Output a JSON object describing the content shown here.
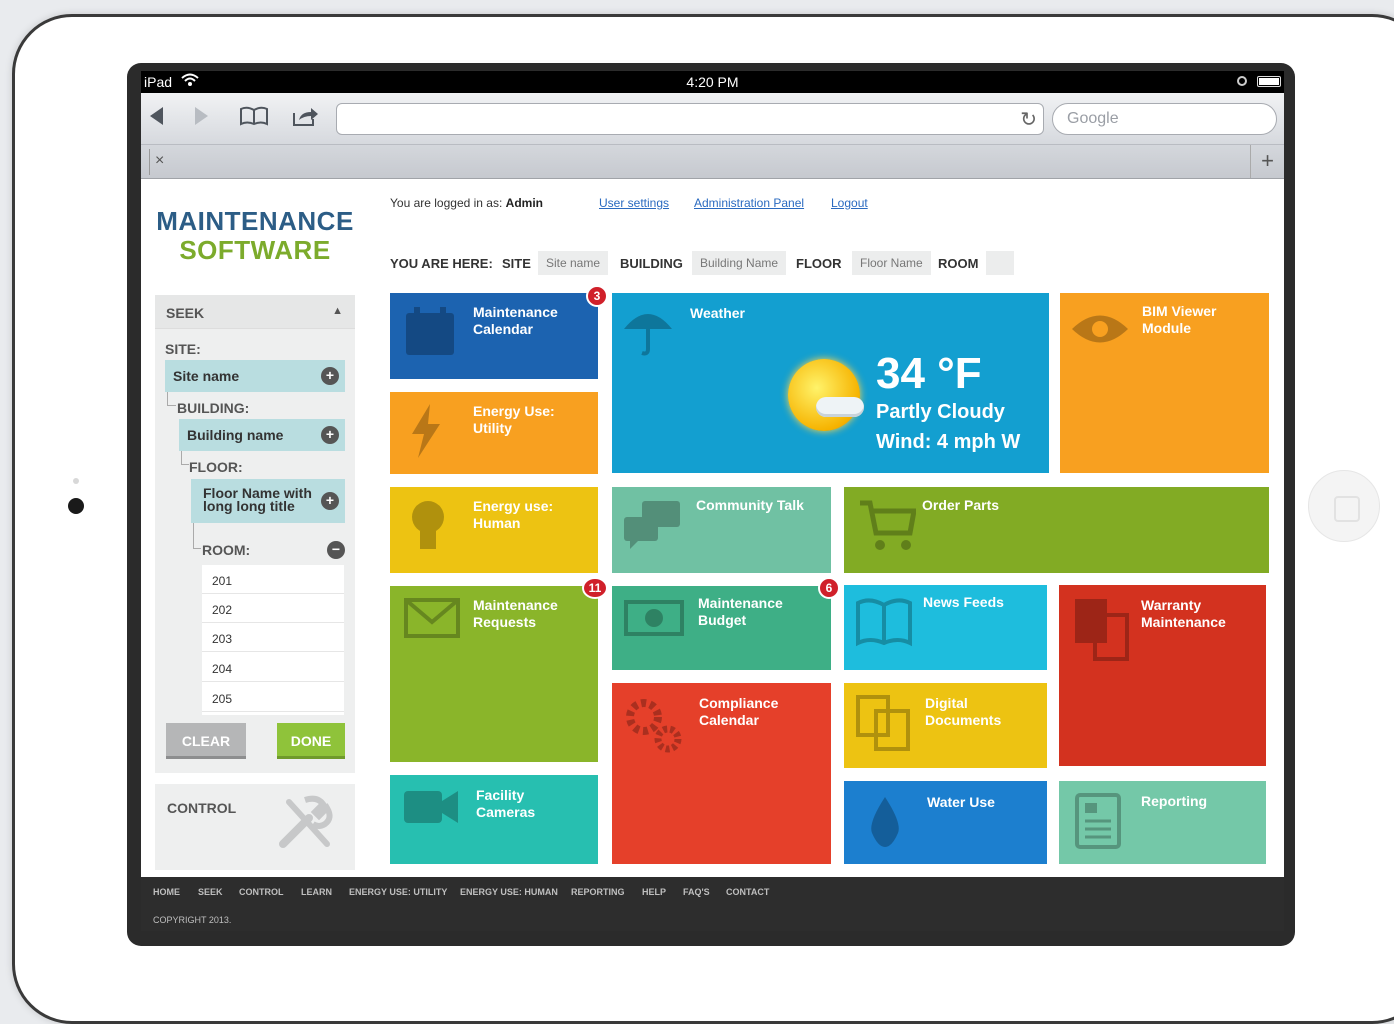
{
  "device": {
    "carrier": "iPad",
    "time": "4:20 PM"
  },
  "browser": {
    "search_placeholder": "Google",
    "tab_close": "×",
    "tab_add": "+"
  },
  "header": {
    "logo_line1": "MAINTENANCE",
    "logo_line2": "SOFTWARE",
    "logged_in_prefix": "You are logged in as: ",
    "logged_in_user": "Admin",
    "links": [
      "User settings",
      "Administration Panel",
      "Logout"
    ]
  },
  "breadcrumb": {
    "prefix": "YOU ARE HERE:",
    "site_label": "SITE",
    "site_value": "Site name",
    "building_label": "BUILDING",
    "building_value": "Building Name",
    "floor_label": "FLOOR",
    "floor_value": "Floor Name",
    "room_label": "ROOM",
    "room_value": ""
  },
  "seek": {
    "title": "SEEK",
    "site_label": "SITE:",
    "site_value": "Site name",
    "building_label": "BUILDING:",
    "building_value": "Building name",
    "floor_label": "FLOOR:",
    "floor_value": "Floor Name with long long title",
    "room_label": "ROOM:",
    "rooms": [
      "201",
      "202",
      "203",
      "204",
      "205"
    ],
    "clear_label": "CLEAR",
    "done_label": "DONE"
  },
  "control": {
    "title": "CONTROL"
  },
  "tiles": {
    "maintenance_calendar": {
      "label": "Maintenance\nCalendar",
      "badge": "3",
      "color": "#1c63b0"
    },
    "energy_utility": {
      "label": "Energy Use:\nUtility",
      "color": "#f8a020"
    },
    "energy_human": {
      "label": "Energy use:\nHuman",
      "color": "#edc312"
    },
    "maintenance_requests": {
      "label": "Maintenance\nRequests",
      "badge": "11",
      "color": "#8ab52a"
    },
    "facility_cameras": {
      "label": "Facility\nCameras",
      "color": "#27bfb0"
    },
    "weather": {
      "label": "Weather",
      "temp": "34 °F",
      "condition": "Partly Cloudy",
      "wind": "Wind: 4 mph W",
      "color": "#139fd0"
    },
    "bim_viewer": {
      "label": "BIM Viewer\nModule",
      "color": "#f8a020"
    },
    "community_talk": {
      "label": "Community Talk",
      "color": "#70c1a3"
    },
    "order_parts": {
      "label": "Order Parts",
      "color": "#82ab24"
    },
    "maintenance_budget": {
      "label": "Maintenance\nBudget",
      "badge": "6",
      "color": "#3eaf86"
    },
    "compliance_calendar": {
      "label": "Compliance\nCalendar",
      "color": "#e5402a"
    },
    "news_feeds": {
      "label": "News Feeds",
      "color": "#1ebddd"
    },
    "digital_documents": {
      "label": "Digital\nDocuments",
      "color": "#edc312"
    },
    "water_use": {
      "label": "Water Use",
      "color": "#1c7fcf"
    },
    "warranty_maintenance": {
      "label": "Warranty\nMaintenance",
      "color": "#d3321f"
    },
    "reporting": {
      "label": "Reporting",
      "color": "#74c8a8"
    }
  },
  "footer": {
    "links": [
      "HOME",
      "SEEK",
      "CONTROL",
      "LEARN",
      "ENERGY USE: UTILITY",
      "ENERGY USE: HUMAN",
      "REPORTING",
      "HELP",
      "FAQ'S",
      "CONTACT"
    ],
    "copyright": "COPYRIGHT 2013."
  }
}
